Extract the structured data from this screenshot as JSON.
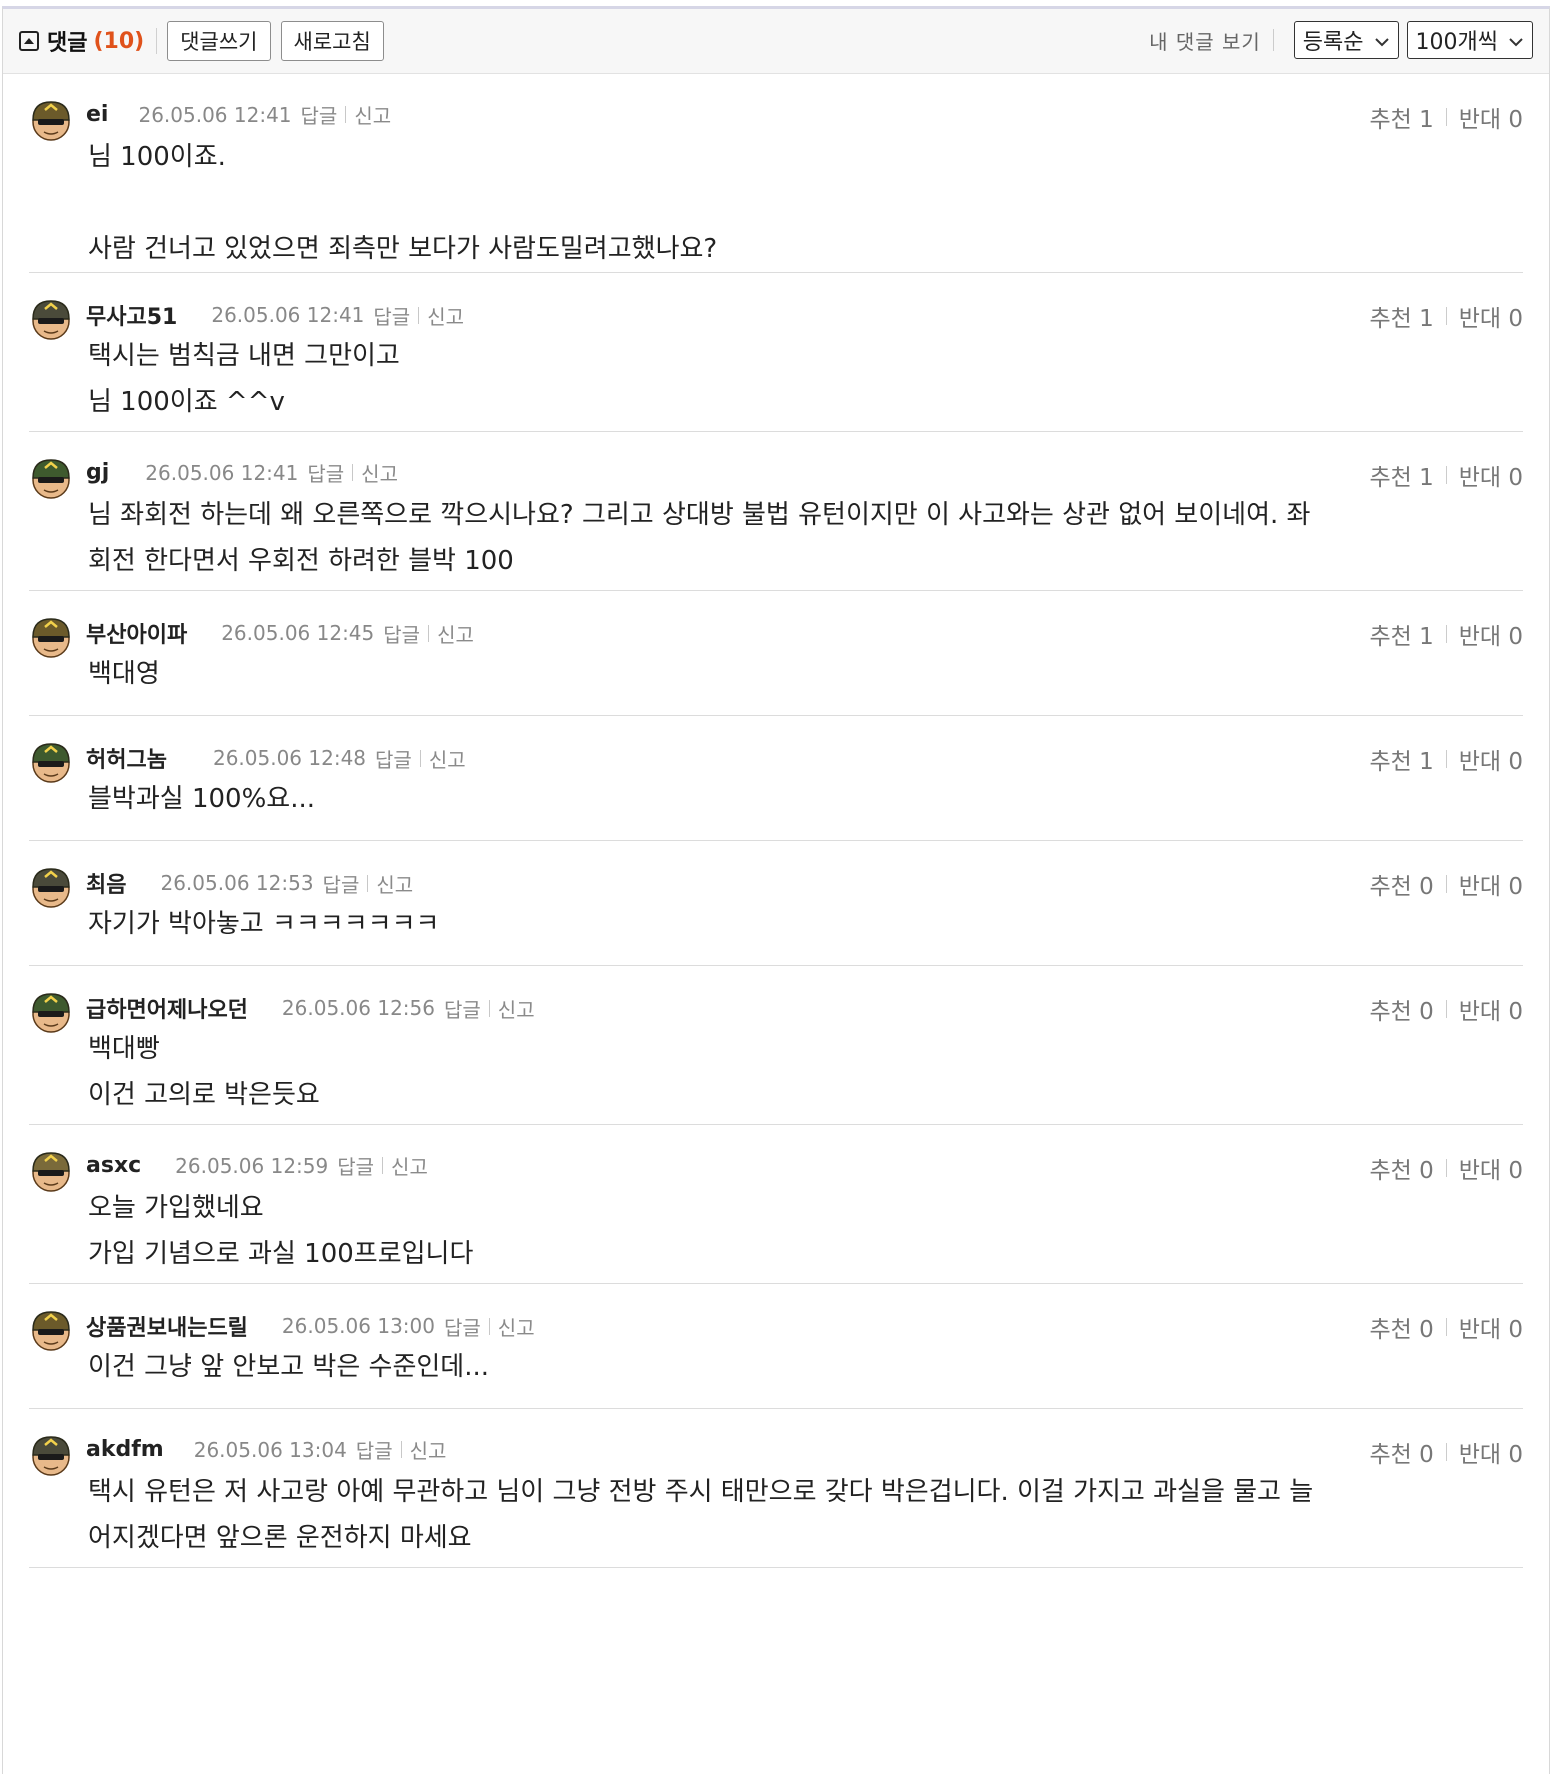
{
  "header": {
    "title": "댓글",
    "count": "(10)",
    "write_label": "댓글쓰기",
    "refresh_label": "새로고침",
    "my_comments_label": "내 댓글 보기",
    "sort_value": "등록순",
    "per_page_value": "100개씩"
  },
  "comments": [
    {
      "nick": "ei",
      "date": "26.05.06 12:41",
      "reply": "답글",
      "report": "신고",
      "up_label": "추천 1",
      "down_label": "반대 0",
      "lines": [
        "님 100이죠.",
        "",
        "사람 건너고 있었으면 죄측만 보다가 사람도밀려고했나요?"
      ]
    },
    {
      "nick": "무사고51",
      "date": "26.05.06 12:41",
      "reply": "답글",
      "report": "신고",
      "up_label": "추천 1",
      "down_label": "반대 0",
      "lines": [
        "택시는 범칙금 내면 그만이고",
        "님 100이죠 ^^v"
      ]
    },
    {
      "nick": "gj",
      "date": "26.05.06 12:41",
      "reply": "답글",
      "report": "신고",
      "up_label": "추천 1",
      "down_label": "반대 0",
      "lines": [
        "님 좌회전 하는데 왜 오른쪽으로 깍으시나요? 그리고 상대방 불법 유턴이지만 이 사고와는 상관 없어 보이네여. 좌",
        "회전 한다면서 우회전 하려한 블박 100"
      ]
    },
    {
      "nick": "부산아이파",
      "date": "26.05.06 12:45",
      "reply": "답글",
      "report": "신고",
      "up_label": "추천 1",
      "down_label": "반대 0",
      "lines": [
        "백대영"
      ]
    },
    {
      "nick": "허허그놈",
      "date": "26.05.06 12:48",
      "reply": "답글",
      "report": "신고",
      "up_label": "추천 1",
      "down_label": "반대 0",
      "lines": [
        "블박과실 100%요..."
      ]
    },
    {
      "nick": "최음",
      "date": "26.05.06 12:53",
      "reply": "답글",
      "report": "신고",
      "up_label": "추천 0",
      "down_label": "반대 0",
      "lines": [
        "자기가 박아놓고 ㅋㅋㅋㅋㅋㅋㅋ"
      ]
    },
    {
      "nick": "급하면어제나오던",
      "date": "26.05.06 12:56",
      "reply": "답글",
      "report": "신고",
      "up_label": "추천 0",
      "down_label": "반대 0",
      "lines": [
        "백대빵",
        "이건 고의로 박은듯요"
      ]
    },
    {
      "nick": "asxc",
      "date": "26.05.06 12:59",
      "reply": "답글",
      "report": "신고",
      "up_label": "추천 0",
      "down_label": "반대 0",
      "lines": [
        "오늘 가입했네요",
        "가입 기념으로 과실 100프로입니다"
      ]
    },
    {
      "nick": "상품권보내는드릴",
      "date": "26.05.06 13:00",
      "reply": "답글",
      "report": "신고",
      "up_label": "추천 0",
      "down_label": "반대 0",
      "lines": [
        "이건 그냥 앞 안보고 박은 수준인데..."
      ]
    },
    {
      "nick": "akdfm",
      "date": "26.05.06 13:04",
      "reply": "답글",
      "report": "신고",
      "up_label": "추천 0",
      "down_label": "반대 0",
      "lines": [
        "택시 유턴은 저 사고랑 아예 무관하고 님이 그냥 전방 주시 태만으로 갖다 박은겁니다. 이걸 가지고 과실을 물고 늘",
        "어지겠다면 앞으론 운전하지 마세요"
      ]
    }
  ]
}
